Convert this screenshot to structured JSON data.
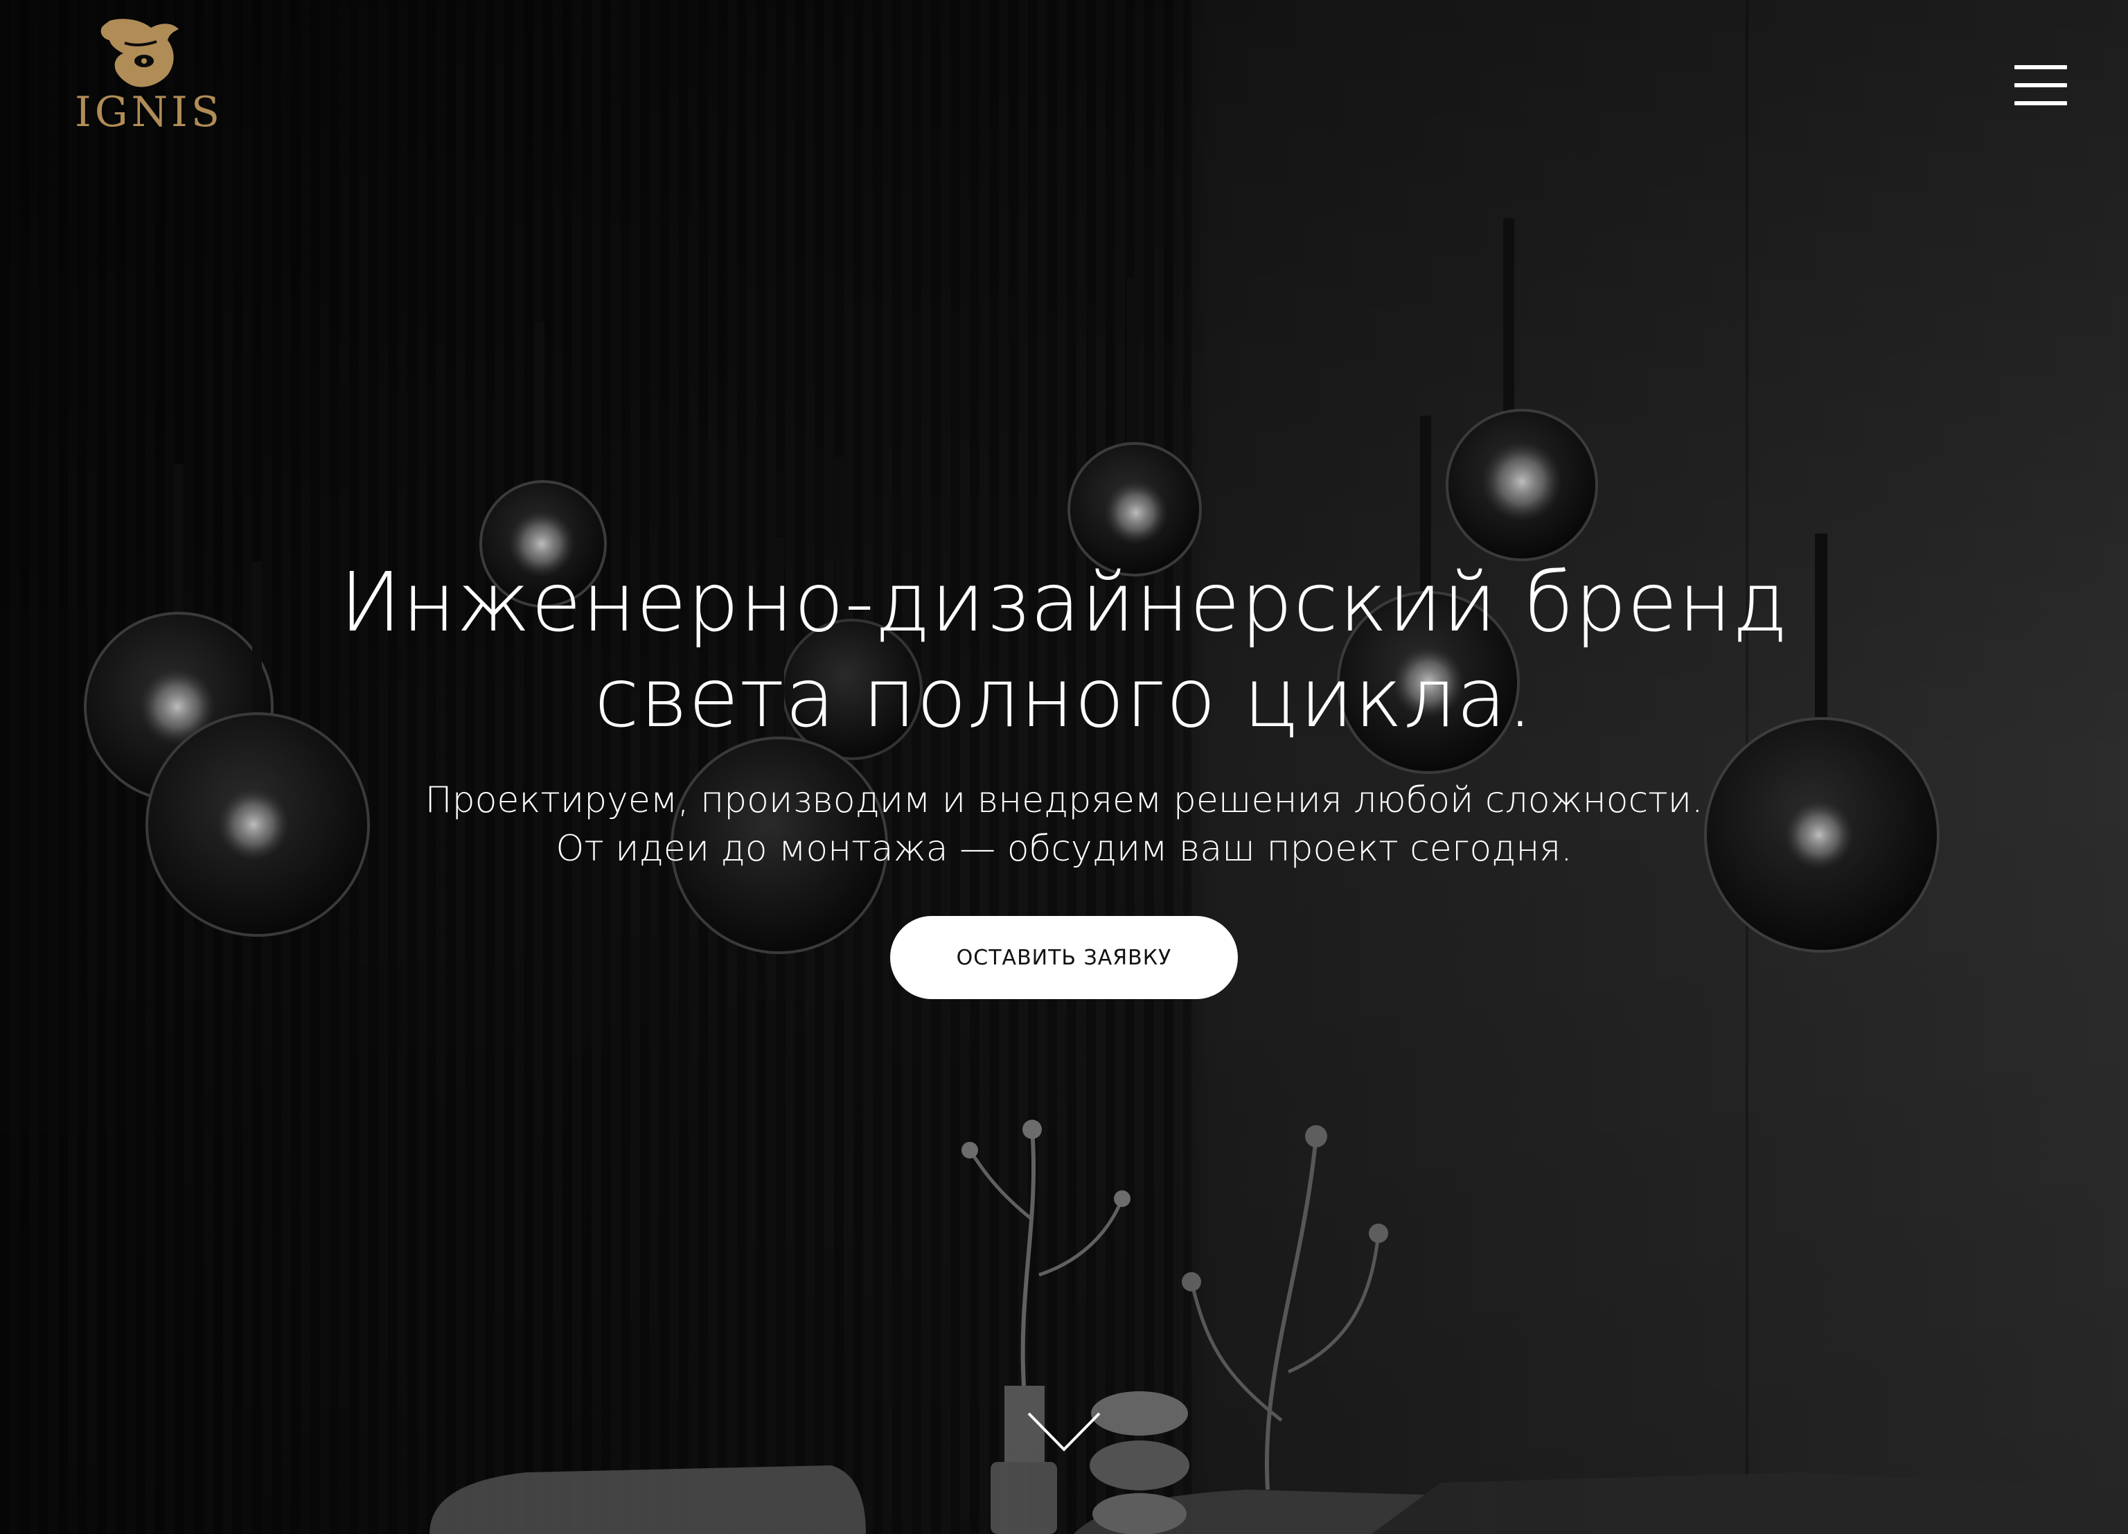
{
  "brand": {
    "name": "IGNIS",
    "logo_icon": "owl-icon",
    "accent_color": "#b08c57"
  },
  "header": {
    "menu_icon": "hamburger-menu-icon"
  },
  "hero": {
    "headline_line1": "Инженерно-дизайнерский бренд",
    "headline_line2": "света полного цикла.",
    "subtitle_line1": "Проектируем, производим и внедряем решения любой сложности.",
    "subtitle_line2": "От идеи до монтажа — обсудим ваш проект сегодня.",
    "cta_label": "ОСТАВИТЬ ЗАЯВКУ",
    "scroll_icon": "chevron-down-icon"
  },
  "colors": {
    "background": "#0b0b0b",
    "text": "#ffffff",
    "button_bg": "#ffffff",
    "button_text": "#111111"
  }
}
